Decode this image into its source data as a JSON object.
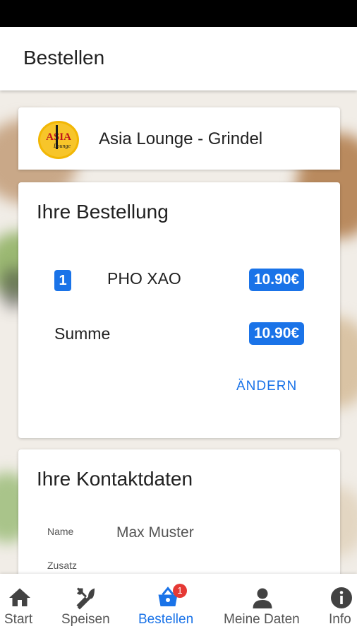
{
  "header": {
    "title": "Bestellen"
  },
  "restaurant": {
    "name": "Asia Lounge - Grindel",
    "logo_text": "ASIA Lounge"
  },
  "order": {
    "title": "Ihre Bestellung",
    "items": [
      {
        "quantity": "1",
        "name": "PHO XAO",
        "price": "10.90€"
      }
    ],
    "sum_label": "Summe",
    "sum_value": "10.90€",
    "change_label": "ÄNDERN"
  },
  "contact": {
    "title": "Ihre Kontaktdaten",
    "fields": [
      {
        "label": "Name",
        "value": "Max Muster"
      },
      {
        "label": "Zusatz",
        "value": ""
      }
    ]
  },
  "nav": {
    "items": [
      {
        "label": "Start",
        "icon": "home-icon"
      },
      {
        "label": "Speisen",
        "icon": "cutlery-icon"
      },
      {
        "label": "Bestellen",
        "icon": "basket-icon",
        "active": true,
        "badge": "1"
      },
      {
        "label": "Meine Daten",
        "icon": "person-icon"
      },
      {
        "label": "Info",
        "icon": "info-icon"
      }
    ]
  },
  "colors": {
    "accent": "#1a73e8",
    "badge": "#e53935"
  }
}
